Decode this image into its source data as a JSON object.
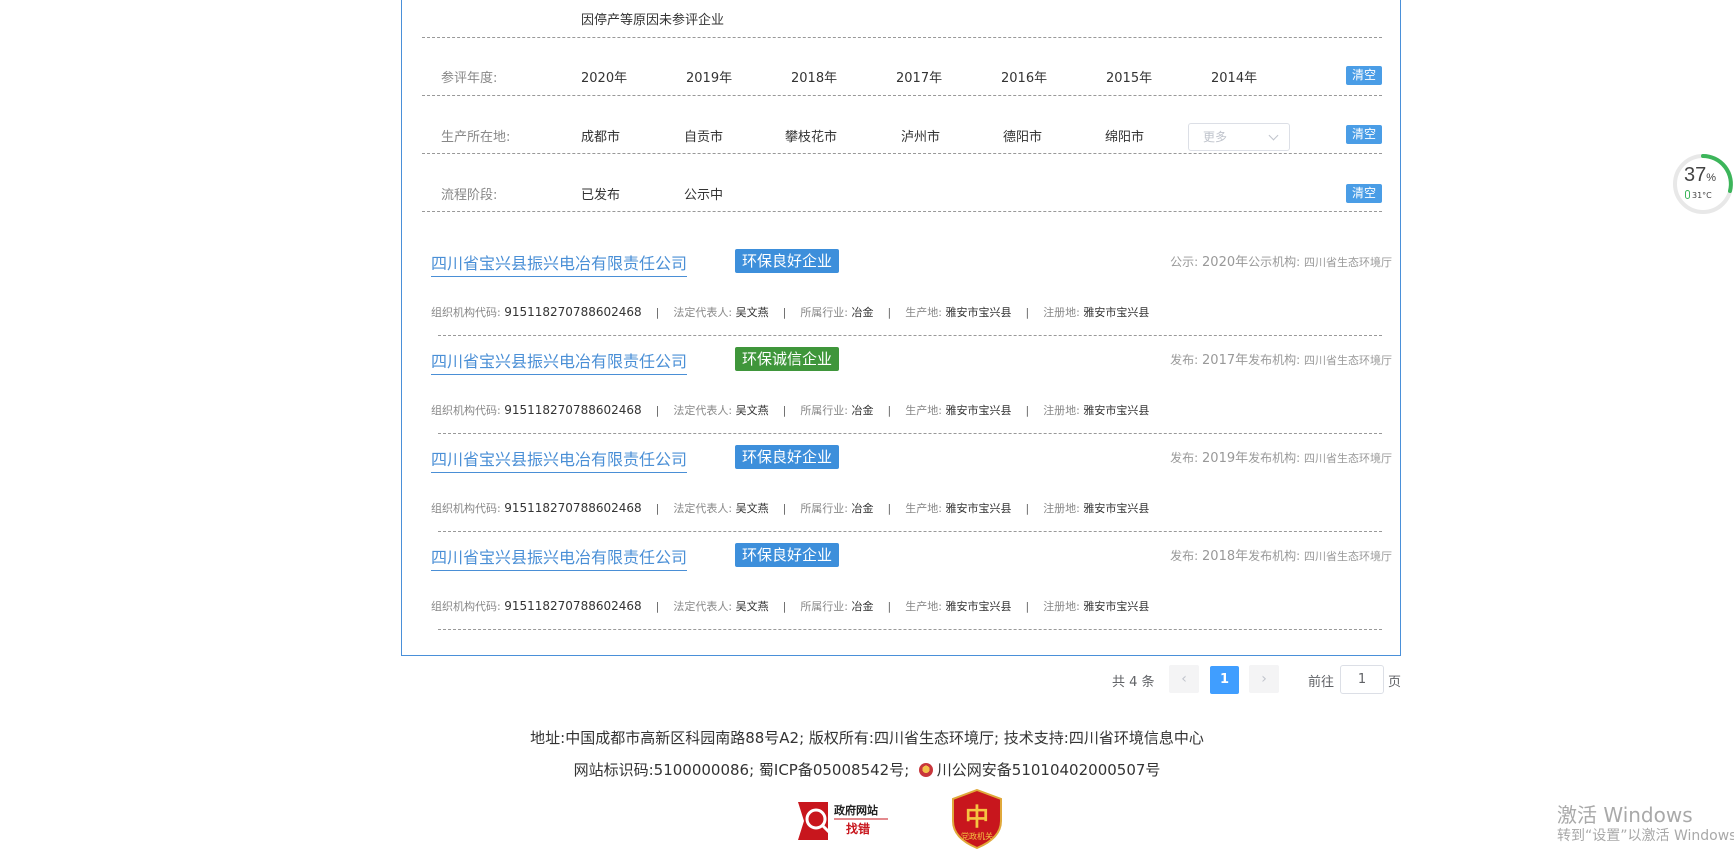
{
  "filters": {
    "top_option": "因停产等原因未参评企业",
    "year": {
      "label": "参评年度:",
      "options": [
        "2020年",
        "2019年",
        "2018年",
        "2017年",
        "2016年",
        "2015年",
        "2014年"
      ],
      "clear": "清空"
    },
    "location": {
      "label": "生产所在地:",
      "options": [
        "成都市",
        "自贡市",
        "攀枝花市",
        "泸州市",
        "德阳市",
        "绵阳市"
      ],
      "more_placeholder": "更多",
      "clear": "清空"
    },
    "stage": {
      "label": "流程阶段:",
      "options": [
        "已发布",
        "公示中"
      ],
      "clear": "清空"
    }
  },
  "records": [
    {
      "company": "四川省宝兴县振兴电冶有限责任公司",
      "badge": "环保良好企业",
      "badge_color": "#3d8fdb",
      "pub_prefix": "公示:",
      "pub_year": "2020年",
      "org_label": "公示机构:",
      "org": "四川省生态环境厅",
      "code_label": "组织机构代码:",
      "code": "915118270788602468",
      "rep_label": "法定代表人:",
      "rep": "吴文燕",
      "industry_label": "所属行业:",
      "industry": "冶金",
      "prod_label": "生产地:",
      "prod": "雅安市宝兴县",
      "reg_label": "注册地:",
      "reg": "雅安市宝兴县"
    },
    {
      "company": "四川省宝兴县振兴电冶有限责任公司",
      "badge": "环保诚信企业",
      "badge_color": "#3f963b",
      "pub_prefix": "发布:",
      "pub_year": "2017年",
      "org_label": "发布机构:",
      "org": "四川省生态环境厅",
      "code_label": "组织机构代码:",
      "code": "915118270788602468",
      "rep_label": "法定代表人:",
      "rep": "吴文燕",
      "industry_label": "所属行业:",
      "industry": "冶金",
      "prod_label": "生产地:",
      "prod": "雅安市宝兴县",
      "reg_label": "注册地:",
      "reg": "雅安市宝兴县"
    },
    {
      "company": "四川省宝兴县振兴电冶有限责任公司",
      "badge": "环保良好企业",
      "badge_color": "#3d8fdb",
      "pub_prefix": "发布:",
      "pub_year": "2019年",
      "org_label": "发布机构:",
      "org": "四川省生态环境厅",
      "code_label": "组织机构代码:",
      "code": "915118270788602468",
      "rep_label": "法定代表人:",
      "rep": "吴文燕",
      "industry_label": "所属行业:",
      "industry": "冶金",
      "prod_label": "生产地:",
      "prod": "雅安市宝兴县",
      "reg_label": "注册地:",
      "reg": "雅安市宝兴县"
    },
    {
      "company": "四川省宝兴县振兴电冶有限责任公司",
      "badge": "环保良好企业",
      "badge_color": "#3d8fdb",
      "pub_prefix": "发布:",
      "pub_year": "2018年",
      "org_label": "发布机构:",
      "org": "四川省生态环境厅",
      "code_label": "组织机构代码:",
      "code": "915118270788602468",
      "rep_label": "法定代表人:",
      "rep": "吴文燕",
      "industry_label": "所属行业:",
      "industry": "冶金",
      "prod_label": "生产地:",
      "prod": "雅安市宝兴县",
      "reg_label": "注册地:",
      "reg": "雅安市宝兴县"
    }
  ],
  "pagination": {
    "total": "共 4 条",
    "prev": "‹",
    "current": "1",
    "next": "›",
    "goto_label": "前往",
    "goto_value": "1",
    "page_suffix": "页"
  },
  "footer": {
    "line1": "地址:中国成都市高新区科园南路88号A2;   版权所有:四川省生态环境厅;   技术支持:四川省环境信息中心",
    "line2_a": "网站标识码:5100000086;   蜀ICP备05008542号;",
    "line2_b": "川公网安备51010402000507号",
    "gov_logo_top": "政府网站",
    "gov_logo_bottom": "找错",
    "party_logo": "党政机关"
  },
  "widget": {
    "percent": "37",
    "percent_sign": "%",
    "temp": "31°C",
    "ring_color": "#3cb55a"
  },
  "watermark": {
    "line1": "激活 Windows",
    "line2": "转到“设置”以激活 Windows。"
  }
}
